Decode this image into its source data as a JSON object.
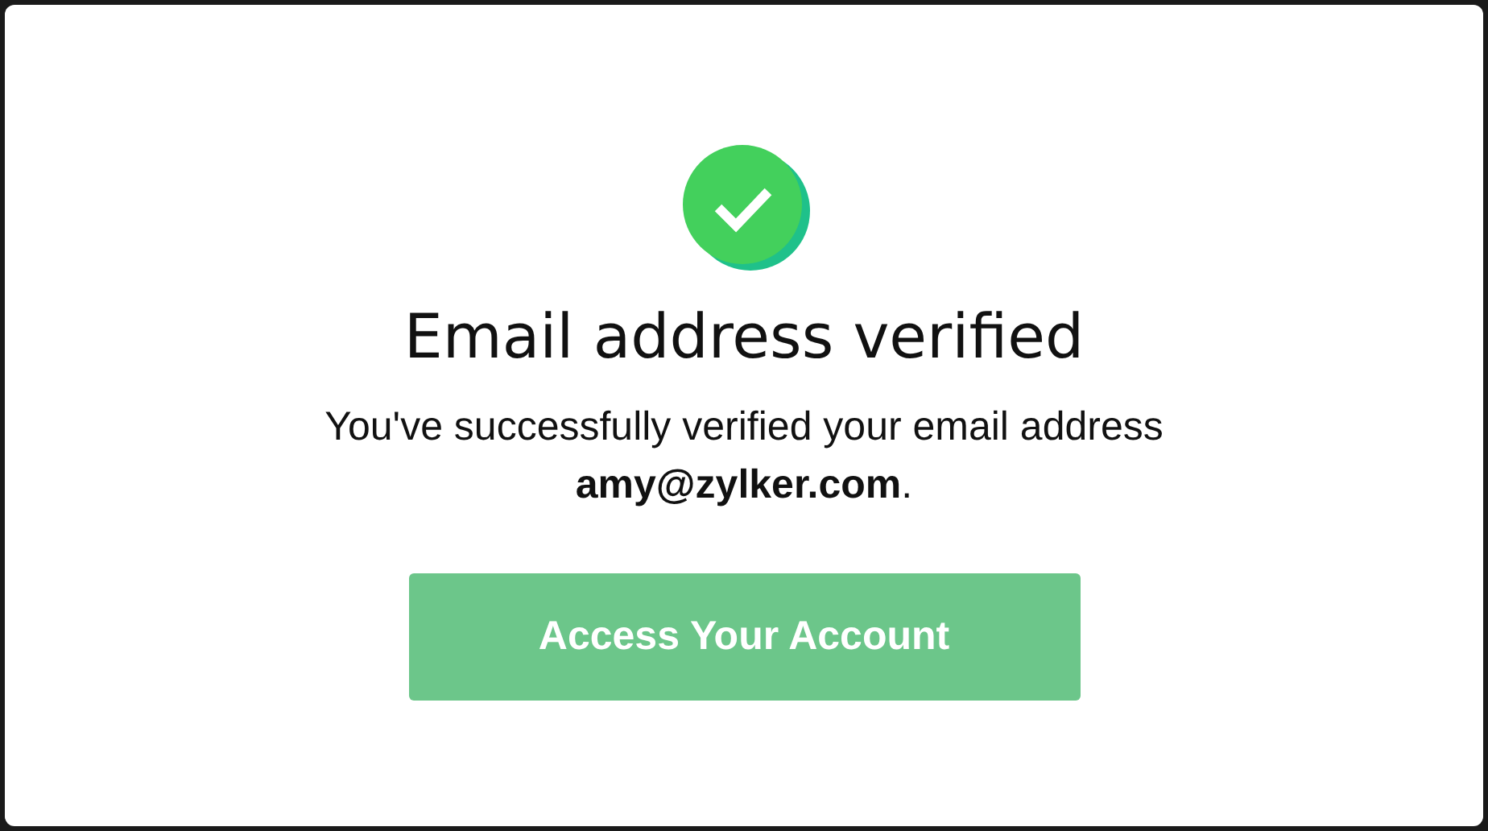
{
  "dialog": {
    "title": "Email address verified",
    "message": "You've successfully verified your email address **amy@zylker.com**.",
    "button": {
      "label": "Access Your Account"
    }
  }
}
